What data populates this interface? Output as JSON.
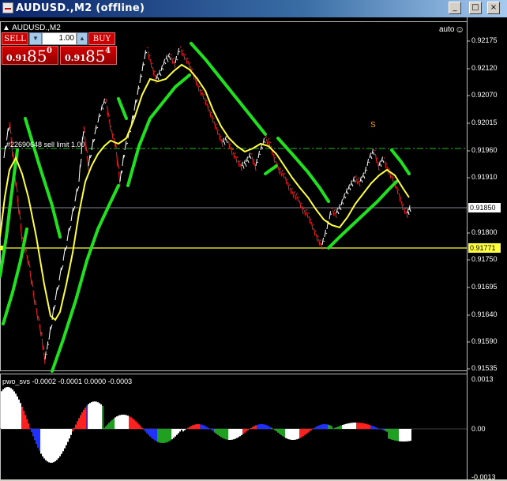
{
  "window": {
    "title": "AUDUSD.,M2 (offline)",
    "buttons": [
      "_",
      "□",
      "×"
    ]
  },
  "chart": {
    "symbol_label": "AUDUSD.,M2",
    "auto_label": "auto",
    "smiley": "☺",
    "order_line_label": "#22690648 sell limit 1.00",
    "signal_label": "S",
    "y_axis_labels": [
      "0.92175",
      "0.92120",
      "0.92070",
      "0.92015",
      "0.91960",
      "0.91910",
      "0.91800",
      "0.91750",
      "0.91695",
      "0.91640",
      "0.91590",
      "0.91535"
    ],
    "current_price_label": "0.91850",
    "level_price_label": "0.91771",
    "colors": {
      "background": "#000000",
      "up_bar": "#ffffff",
      "down_bar": "#ff2020",
      "ma_yellow": "#ffff40",
      "green_band": "#20e020",
      "order_line": "#20c020",
      "level_line": "#ffff40"
    }
  },
  "trade_panel": {
    "sell_label": "SELL",
    "buy_label": "BUY",
    "lot_value": "1.00",
    "lot_down": "▼",
    "lot_up": "▲",
    "sell_price_small": "0.91",
    "sell_price_big": "85",
    "sell_price_sup": "0",
    "buy_price_small": "0.91",
    "buy_price_big": "85",
    "buy_price_sup": "4"
  },
  "indicator": {
    "title": "pwo_svs -0.0002 -0.0001 0.0000 -0.0003",
    "y_axis_labels": [
      "0.0013",
      "0.00",
      "-0.0013"
    ],
    "colors": [
      "#ffffff",
      "#ff2020",
      "#2030ff",
      "#20a020"
    ]
  }
}
